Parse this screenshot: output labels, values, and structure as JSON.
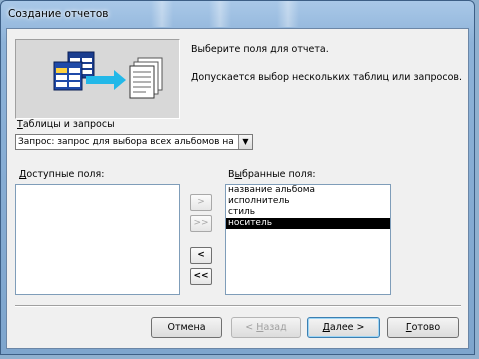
{
  "window": {
    "title": "Создание отчетов"
  },
  "instructions": {
    "line1": "Выберите поля для отчета.",
    "line2": "Допускается выбор нескольких таблиц или запросов."
  },
  "source": {
    "label_prefix": "",
    "label_underlined": "Т",
    "label_rest": "аблицы и запросы",
    "selected_value": "Запрос: запрос для выбора всех альбомов на к"
  },
  "available_fields": {
    "label_underlined": "Д",
    "label_rest": "оступные поля:",
    "items": []
  },
  "selected_fields": {
    "label_prefix": "В",
    "label_underlined": "ы",
    "label_rest": "бранные поля:",
    "items": [
      "название альбома",
      "исполнитель",
      "стиль",
      "носитель"
    ],
    "selected_index": 3
  },
  "move_buttons": {
    "add_one": ">",
    "add_all": ">>",
    "remove_one": "<",
    "remove_all": "<<"
  },
  "buttons": {
    "cancel": "Отмена",
    "back_prefix": "< ",
    "back_underlined": "Н",
    "back_rest": "азад",
    "next_underlined": "Д",
    "next_rest": "алее >",
    "finish_underlined": "Г",
    "finish_rest": "отово"
  },
  "icons": {
    "wizard_picture": "tables-to-report-icon",
    "combo_arrow": "chevron-down-icon"
  },
  "colors": {
    "selection_bg": "#000000",
    "title_glass": "#8db2d8"
  }
}
